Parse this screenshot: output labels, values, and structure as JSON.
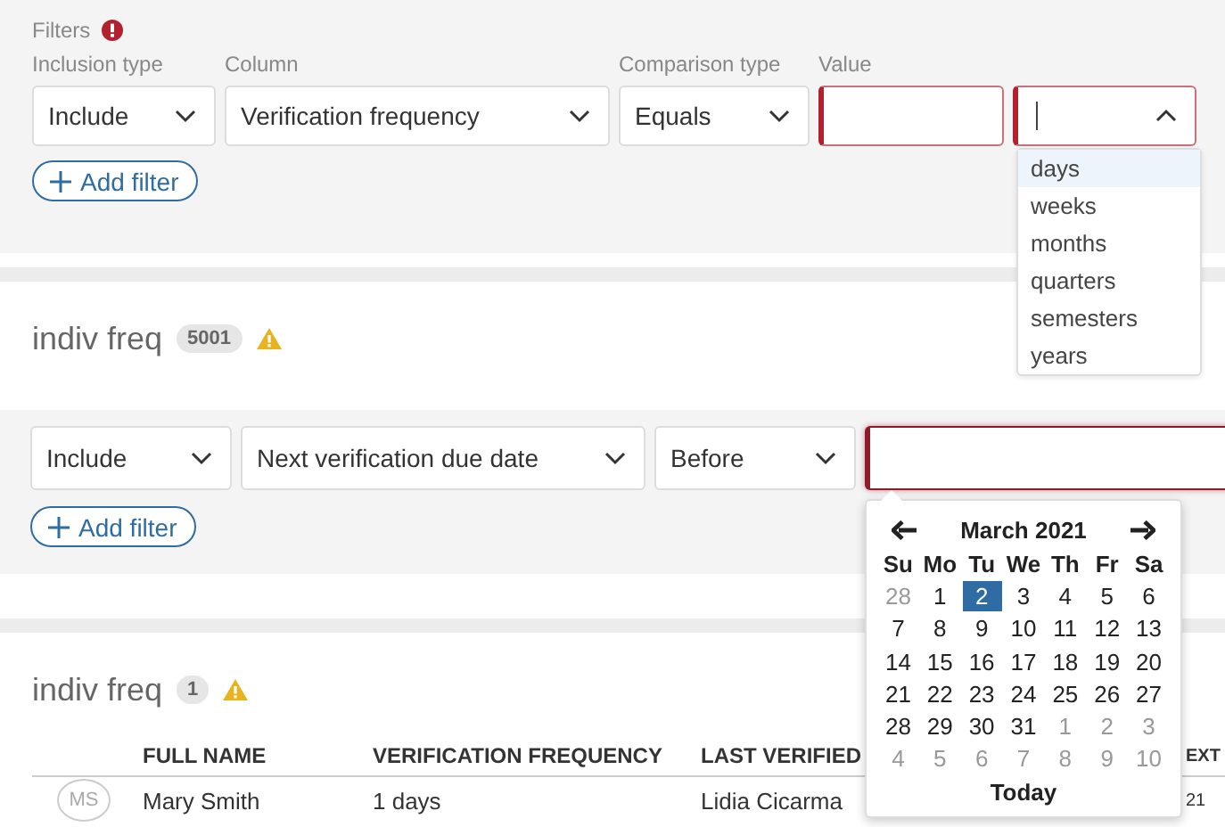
{
  "blocks": [
    {
      "kind": "filters",
      "title": "Filters",
      "error": true,
      "fields": [
        {
          "kind": "select",
          "label": "Inclusion type",
          "value": "Include"
        },
        {
          "kind": "select",
          "label": "Column",
          "value": "Verification frequency"
        },
        {
          "kind": "select",
          "label": "Comparison type",
          "value": "Equals"
        },
        {
          "kind": "input",
          "label": "Value",
          "invalid": true
        },
        {
          "kind": "combo",
          "invalid": true,
          "expanded": true,
          "options": [
            {
              "label": "days",
              "selected": true
            },
            {
              "label": "weeks",
              "selected": false
            },
            {
              "label": "months",
              "selected": false
            },
            {
              "label": "quarters",
              "selected": false
            },
            {
              "label": "semesters",
              "selected": false
            },
            {
              "label": "years",
              "selected": false
            }
          ]
        }
      ],
      "add_filter": "Add filter"
    },
    {
      "kind": "heading",
      "title": "indiv freq",
      "count": "5001",
      "warning": true
    },
    {
      "kind": "filters",
      "fields": [
        {
          "kind": "select",
          "value": "Include"
        },
        {
          "kind": "select",
          "value": "Next verification due date"
        },
        {
          "kind": "select",
          "value": "Before"
        },
        {
          "kind": "date",
          "invalid": true,
          "expanded": true,
          "calendar": {
            "month": "March 2021",
            "weekdays": [
              "Su",
              "Mo",
              "Tu",
              "We",
              "Th",
              "Fr",
              "Sa"
            ],
            "weeks": [
              [
                {
                  "day": "28",
                  "other_month": true,
                  "selected": false
                },
                {
                  "day": "1",
                  "other_month": false,
                  "selected": false
                },
                {
                  "day": "2",
                  "other_month": false,
                  "selected": true
                },
                {
                  "day": "3",
                  "other_month": false,
                  "selected": false
                },
                {
                  "day": "4",
                  "other_month": false,
                  "selected": false
                },
                {
                  "day": "5",
                  "other_month": false,
                  "selected": false
                },
                {
                  "day": "6",
                  "other_month": false,
                  "selected": false
                }
              ],
              [
                {
                  "day": "7",
                  "other_month": false,
                  "selected": false
                },
                {
                  "day": "8",
                  "other_month": false,
                  "selected": false
                },
                {
                  "day": "9",
                  "other_month": false,
                  "selected": false
                },
                {
                  "day": "10",
                  "other_month": false,
                  "selected": false
                },
                {
                  "day": "11",
                  "other_month": false,
                  "selected": false
                },
                {
                  "day": "12",
                  "other_month": false,
                  "selected": false
                },
                {
                  "day": "13",
                  "other_month": false,
                  "selected": false
                }
              ],
              [
                {
                  "day": "14",
                  "other_month": false,
                  "selected": false
                },
                {
                  "day": "15",
                  "other_month": false,
                  "selected": false
                },
                {
                  "day": "16",
                  "other_month": false,
                  "selected": false
                },
                {
                  "day": "17",
                  "other_month": false,
                  "selected": false
                },
                {
                  "day": "18",
                  "other_month": false,
                  "selected": false
                },
                {
                  "day": "19",
                  "other_month": false,
                  "selected": false
                },
                {
                  "day": "20",
                  "other_month": false,
                  "selected": false
                }
              ],
              [
                {
                  "day": "21",
                  "other_month": false,
                  "selected": false
                },
                {
                  "day": "22",
                  "other_month": false,
                  "selected": false
                },
                {
                  "day": "23",
                  "other_month": false,
                  "selected": false
                },
                {
                  "day": "24",
                  "other_month": false,
                  "selected": false
                },
                {
                  "day": "25",
                  "other_month": false,
                  "selected": false
                },
                {
                  "day": "26",
                  "other_month": false,
                  "selected": false
                },
                {
                  "day": "27",
                  "other_month": false,
                  "selected": false
                }
              ],
              [
                {
                  "day": "28",
                  "other_month": false,
                  "selected": false
                },
                {
                  "day": "29",
                  "other_month": false,
                  "selected": false
                },
                {
                  "day": "30",
                  "other_month": false,
                  "selected": false
                },
                {
                  "day": "31",
                  "other_month": false,
                  "selected": false
                },
                {
                  "day": "1",
                  "other_month": true,
                  "selected": false
                },
                {
                  "day": "2",
                  "other_month": true,
                  "selected": false
                },
                {
                  "day": "3",
                  "other_month": true,
                  "selected": false
                }
              ],
              [
                {
                  "day": "4",
                  "other_month": true,
                  "selected": false
                },
                {
                  "day": "5",
                  "other_month": true,
                  "selected": false
                },
                {
                  "day": "6",
                  "other_month": true,
                  "selected": false
                },
                {
                  "day": "7",
                  "other_month": true,
                  "selected": false
                },
                {
                  "day": "8",
                  "other_month": true,
                  "selected": false
                },
                {
                  "day": "9",
                  "other_month": true,
                  "selected": false
                },
                {
                  "day": "10",
                  "other_month": true,
                  "selected": false
                }
              ]
            ],
            "today": "Today"
          }
        }
      ],
      "add_filter": "Add filter"
    },
    {
      "kind": "heading",
      "title": "indiv freq",
      "count": "1",
      "warning": true
    },
    {
      "kind": "table",
      "columns": [
        "FULL NAME",
        "VERIFICATION FREQUENCY",
        "LAST VERIFIED",
        "EXT"
      ],
      "rows": [
        {
          "avatar": "MS",
          "cells": [
            "Mary Smith",
            "1 days",
            "Lidia Cicarma",
            "21"
          ]
        }
      ]
    }
  ]
}
